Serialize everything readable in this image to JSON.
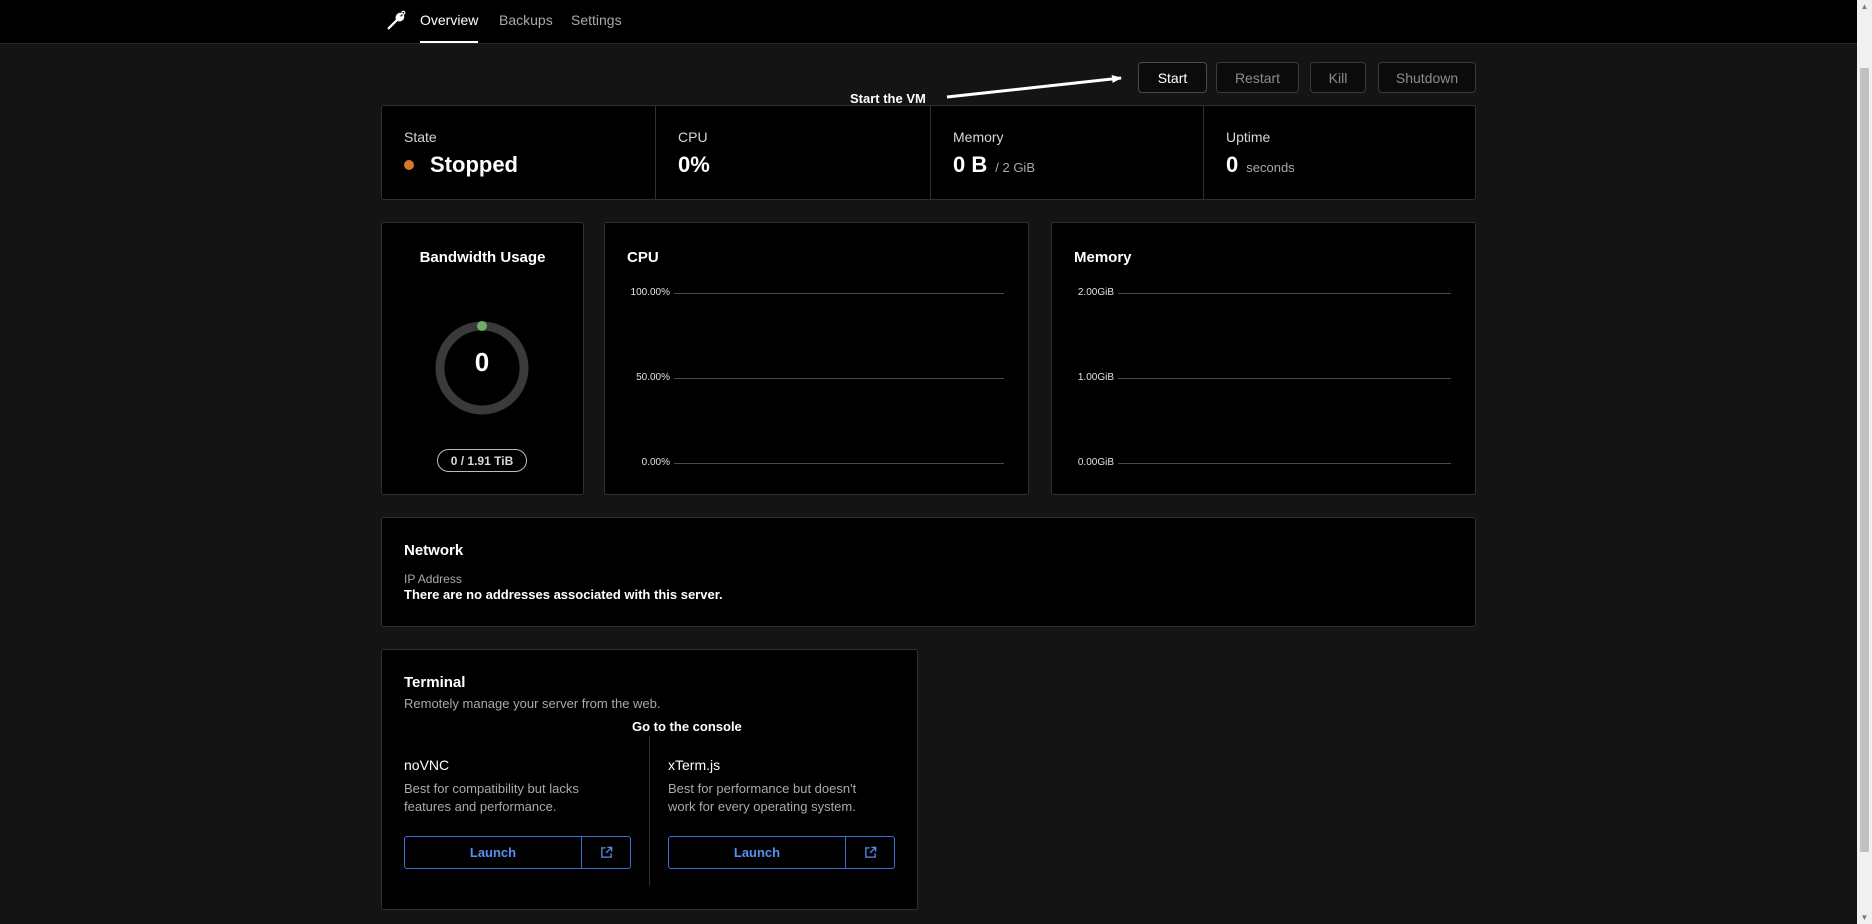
{
  "nav": {
    "tabs": [
      {
        "label": "Overview",
        "active": true
      },
      {
        "label": "Backups",
        "active": false
      },
      {
        "label": "Settings",
        "active": false
      }
    ]
  },
  "actions": {
    "start": "Start",
    "restart": "Restart",
    "kill": "Kill",
    "shutdown": "Shutdown"
  },
  "annotations": {
    "start_vm": "Start the VM",
    "console": "Go to the console"
  },
  "stats": {
    "state": {
      "label": "State",
      "value": "Stopped",
      "color": "#d2782c"
    },
    "cpu": {
      "label": "CPU",
      "value": "0%"
    },
    "memory": {
      "label": "Memory",
      "value": "0 B",
      "sub": "/ 2 GiB"
    },
    "uptime": {
      "label": "Uptime",
      "value": "0",
      "sub": "seconds"
    }
  },
  "bandwidth": {
    "title": "Bandwidth Usage",
    "value": "0",
    "usage": "0 / 1.91 TiB",
    "fraction": 0
  },
  "cpu_chart": {
    "title": "CPU",
    "ticks": [
      "100.00%",
      "50.00%",
      "0.00%"
    ]
  },
  "memory_chart": {
    "title": "Memory",
    "ticks": [
      "2.00GiB",
      "1.00GiB",
      "0.00GiB"
    ]
  },
  "network": {
    "title": "Network",
    "ip_label": "IP Address",
    "ip_value": "There are no addresses associated with this server."
  },
  "terminal": {
    "title": "Terminal",
    "subtitle": "Remotely manage your server from the web.",
    "options": [
      {
        "name": "noVNC",
        "desc_line1": "Best for compatibility but lacks",
        "desc_line2": "features and performance.",
        "button": "Launch"
      },
      {
        "name": "xTerm.js",
        "desc_line1": "Best for performance but doesn't",
        "desc_line2": "work for every operating system.",
        "button": "Launch"
      }
    ]
  },
  "chart_data": [
    {
      "type": "line",
      "title": "CPU",
      "ytick_labels": [
        "100.00%",
        "50.00%",
        "0.00%"
      ],
      "series": []
    },
    {
      "type": "line",
      "title": "Memory",
      "ytick_labels": [
        "2.00GiB",
        "1.00GiB",
        "0.00GiB"
      ],
      "series": []
    }
  ]
}
